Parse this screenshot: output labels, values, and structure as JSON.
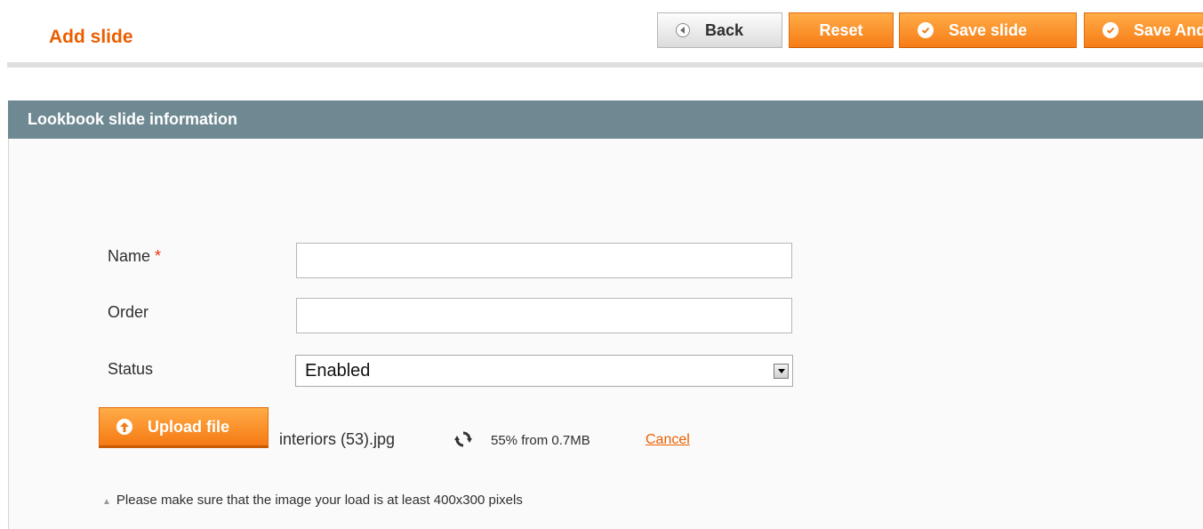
{
  "header": {
    "title": "Add slide"
  },
  "toolbar": {
    "back_label": "Back",
    "reset_label": "Reset",
    "save_label": "Save slide",
    "save_continue_label": "Save And Continue Edit"
  },
  "fieldset": {
    "title": "Lookbook slide information"
  },
  "form": {
    "name": {
      "label": "Name",
      "required_mark": "*",
      "value": ""
    },
    "order": {
      "label": "Order",
      "value": ""
    },
    "status": {
      "label": "Status",
      "selected": "Enabled"
    }
  },
  "upload": {
    "button_label": "Upload file",
    "file_name": "interiors (53).jpg",
    "progress_percent": 55,
    "progress_text": "55% from 0.7MB",
    "cancel_label": "Cancel"
  },
  "note": {
    "text": "Please make sure that the image your load is at least 400x300 pixels"
  },
  "colors": {
    "accent": "#eb5e00",
    "button_orange": "#f77c16",
    "header_bar": "#6f8992"
  },
  "icons": {
    "back": "back-arrow-icon",
    "check": "check-circle-icon",
    "upload": "upload-icon",
    "spinner": "refresh-icon",
    "note": "triangle-icon"
  }
}
